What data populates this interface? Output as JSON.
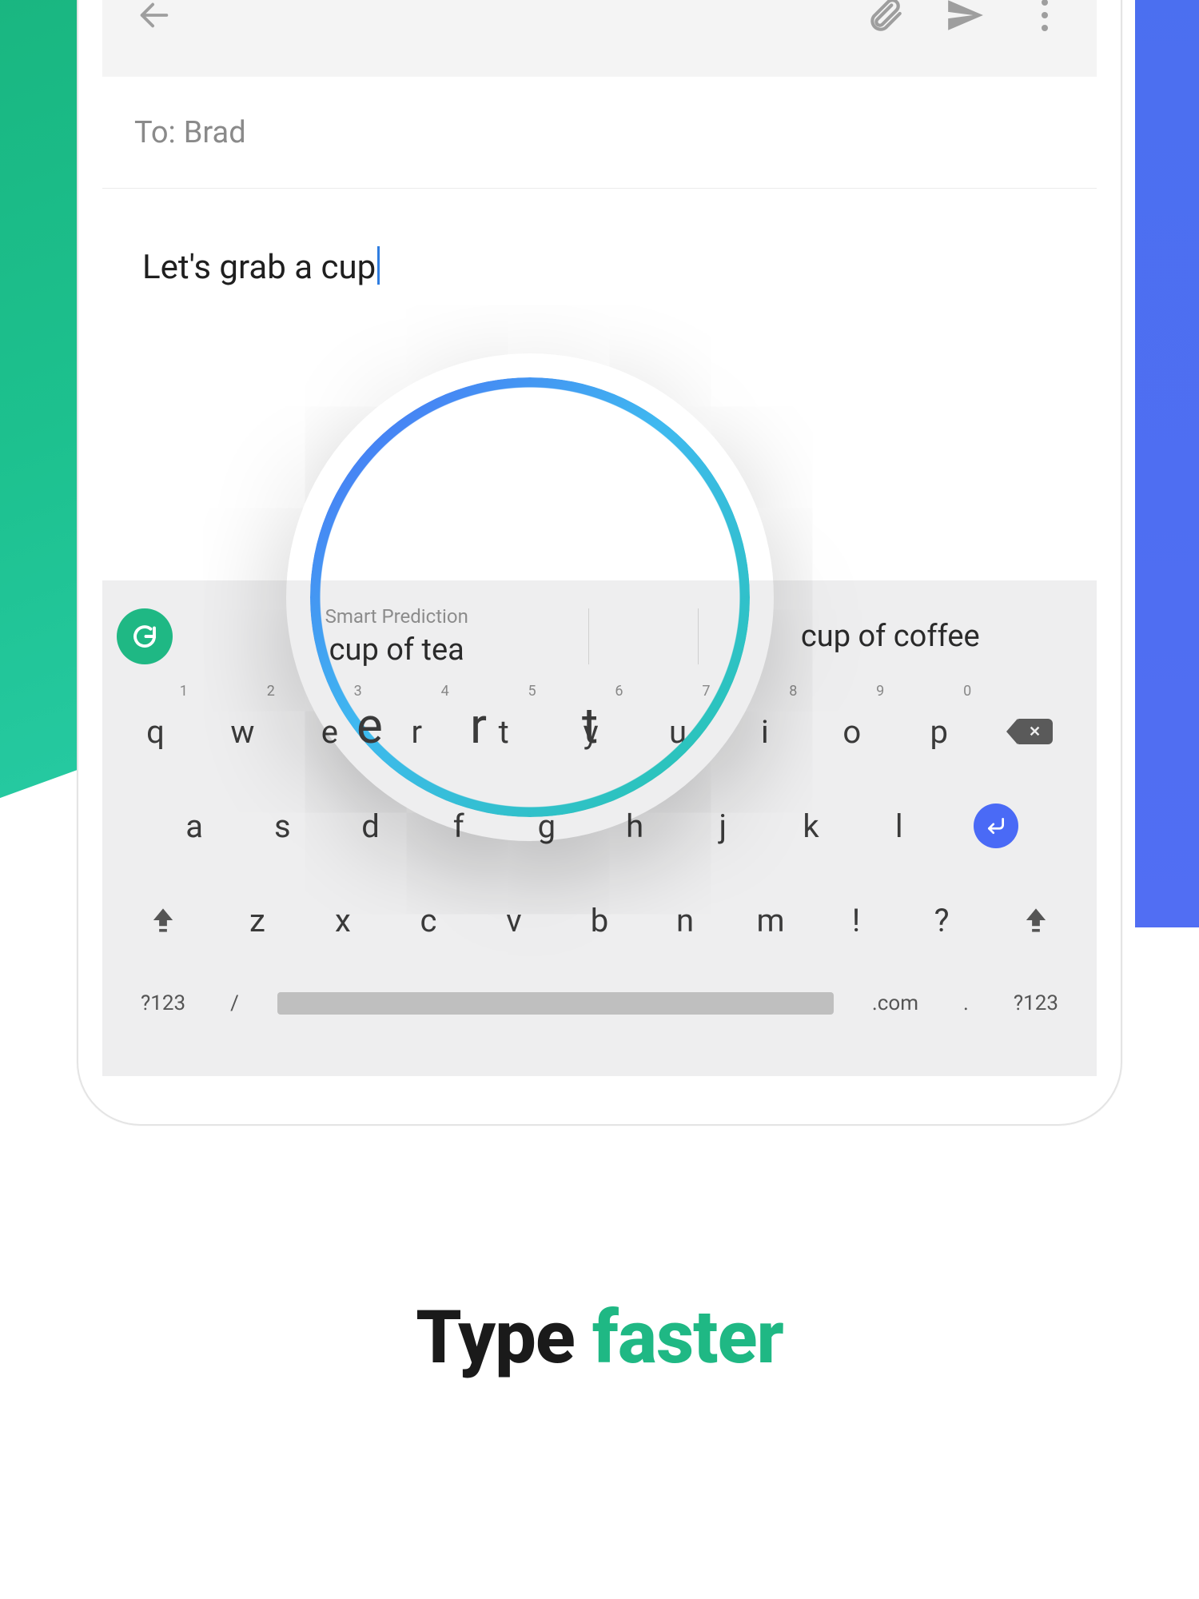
{
  "compose": {
    "to_label": "To:",
    "to_name": "Brad",
    "body": "Let's grab a cup"
  },
  "suggestions": {
    "smart_label": "Smart Prediction",
    "primary": "cup of tea",
    "secondary": "cup of coffee"
  },
  "keyboard": {
    "row1": [
      {
        "k": "q",
        "n": "1"
      },
      {
        "k": "w",
        "n": "2"
      },
      {
        "k": "e",
        "n": "3"
      },
      {
        "k": "r",
        "n": "4"
      },
      {
        "k": "t",
        "n": "5"
      },
      {
        "k": "y",
        "n": "6"
      },
      {
        "k": "u",
        "n": "7"
      },
      {
        "k": "i",
        "n": "8"
      },
      {
        "k": "o",
        "n": "9"
      },
      {
        "k": "p",
        "n": "0"
      }
    ],
    "row2": [
      "a",
      "s",
      "d",
      "f",
      "g",
      "h",
      "j",
      "k",
      "l"
    ],
    "row3": [
      "z",
      "x",
      "c",
      "v",
      "b",
      "n",
      "m",
      "!",
      "?"
    ],
    "sym": "?123",
    "slash": "/",
    "dotcom": ".com",
    "dot": "."
  },
  "tagline": {
    "w1": "Type",
    "w2": "faster"
  },
  "icons": {
    "grammarly": "G"
  }
}
